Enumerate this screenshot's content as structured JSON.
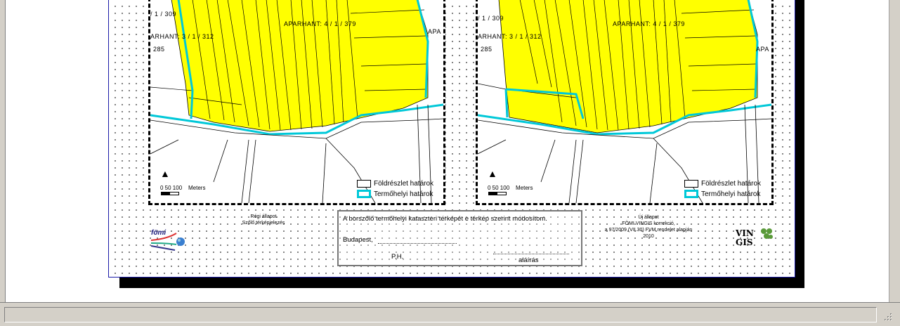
{
  "colors": {
    "parcel_fill": "#ffff00",
    "habitat_boundary": "#00c8d8",
    "page_border": "#1a1aa8"
  },
  "maps": {
    "left": {
      "labels": {
        "aparhant_a": "APARHANT: 4 / 1 / 379",
        "aparhant_b": "ARHANT: 3 / 1 / 312",
        "aparhant_c": "/ 1 / 309",
        "num": "285",
        "edge": "APA"
      },
      "scale": {
        "ticks": "0  50 100",
        "unit": "Meters"
      },
      "legend": {
        "parcel": "Földrészlet határok",
        "habitat": "Termőhelyi határok"
      }
    },
    "right": {
      "labels": {
        "aparhant_a": "APARHANT: 4 / 1 / 379",
        "aparhant_b": "ARHANT: 3 / 1 / 312",
        "aparhant_c": "/ 1 / 309",
        "num": "285",
        "edge": "APA"
      },
      "scale": {
        "ticks": "0  50 100",
        "unit": "Meters"
      },
      "legend": {
        "parcel": "Földrészlet határok",
        "habitat": "Termőhelyi határok"
      }
    }
  },
  "footer": {
    "old_state": {
      "line1": "Régi állapot",
      "line2": "Szőlő térképjelezés"
    },
    "new_state": {
      "line1": "Új állapot",
      "line2": "FÖMI VINGIS korrekció,",
      "line3": "a 97/2009 (VII.30) FVM rendelet alapján",
      "line4": "2010"
    },
    "logo_left": "fömi",
    "logo_right": "VIN GIS",
    "certificate": {
      "statement": "A borszőlő termőhelyi kataszteri térképét e térkép szerint módosítom.",
      "place": "Budapest,",
      "seal": "P.H.",
      "signature": "aláírás"
    }
  },
  "statusbar": {
    "text": ""
  }
}
